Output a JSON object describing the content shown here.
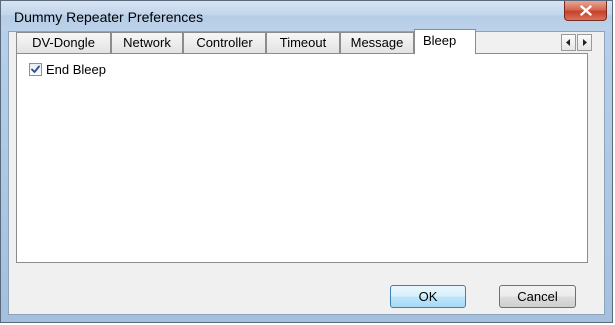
{
  "window": {
    "title": "Dummy Repeater Preferences"
  },
  "tabs": [
    {
      "label": "DV-Dongle",
      "active": false
    },
    {
      "label": "Network",
      "active": false
    },
    {
      "label": "Controller",
      "active": false
    },
    {
      "label": "Timeout",
      "active": false
    },
    {
      "label": "Message",
      "active": false
    },
    {
      "label": "Bleep",
      "active": true
    }
  ],
  "tab_scroll": {
    "left_icon": "arrow-left-icon",
    "right_icon": "arrow-right-icon"
  },
  "bleep_panel": {
    "end_bleep": {
      "label": "End Bleep",
      "checked": true
    }
  },
  "buttons": {
    "ok_label": "OK",
    "cancel_label": "Cancel"
  },
  "colors": {
    "title_bar": "#c3d6ec",
    "close_button": "#c7402a",
    "default_button_border": "#3c7fb1"
  }
}
